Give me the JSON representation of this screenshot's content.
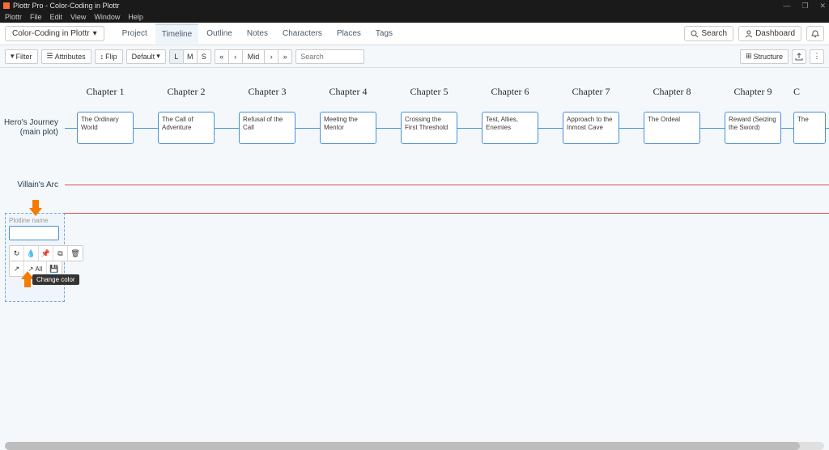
{
  "window": {
    "title": "Plottr Pro - Color-Coding in Plottr",
    "win_buttons": [
      "—",
      "❐",
      "✕"
    ]
  },
  "menu": [
    "Plottr",
    "File",
    "Edit",
    "View",
    "Window",
    "Help"
  ],
  "nav": {
    "book": "Color-Coding in Plottr",
    "tabs": [
      "Project",
      "Timeline",
      "Outline",
      "Notes",
      "Characters",
      "Places",
      "Tags"
    ],
    "active_tab": 1,
    "search_btn": "Search",
    "dashboard_btn": "Dashboard",
    "bell_icon": "bell"
  },
  "toolbar": {
    "filter": "Filter",
    "attributes": "Attributes",
    "flip": "Flip",
    "default": "Default",
    "zoom": [
      "L",
      "M",
      "S"
    ],
    "zoom_active": 0,
    "nav_btns": [
      "«",
      "‹",
      "Mid",
      "›",
      "»"
    ],
    "search_placeholder": "Search",
    "structure_btn": "Structure"
  },
  "chapters": [
    "Chapter 1",
    "Chapter 2",
    "Chapter 3",
    "Chapter 4",
    "Chapter 5",
    "Chapter 6",
    "Chapter 7",
    "Chapter 8",
    "Chapter 9",
    "C"
  ],
  "plotlines": [
    {
      "name": "Hero's Journey (main plot)",
      "color": "#4a90d9",
      "cards": [
        "The Ordinary World",
        "The Call of Adventure",
        "Refusal of the Call",
        "Meeting the Mentor",
        "Crossing the First Threshold",
        "Test, Allies, Enemies",
        "Approach to the Inmost Cave",
        "The Ordeal",
        "Reward (Seizing the Sword)",
        "The"
      ]
    },
    {
      "name": "Villain's Arc",
      "color": "#d9534f",
      "cards": []
    }
  ],
  "editing": {
    "label": "Plotline name",
    "value": "",
    "action_all": "All",
    "tooltip": "Change color"
  }
}
